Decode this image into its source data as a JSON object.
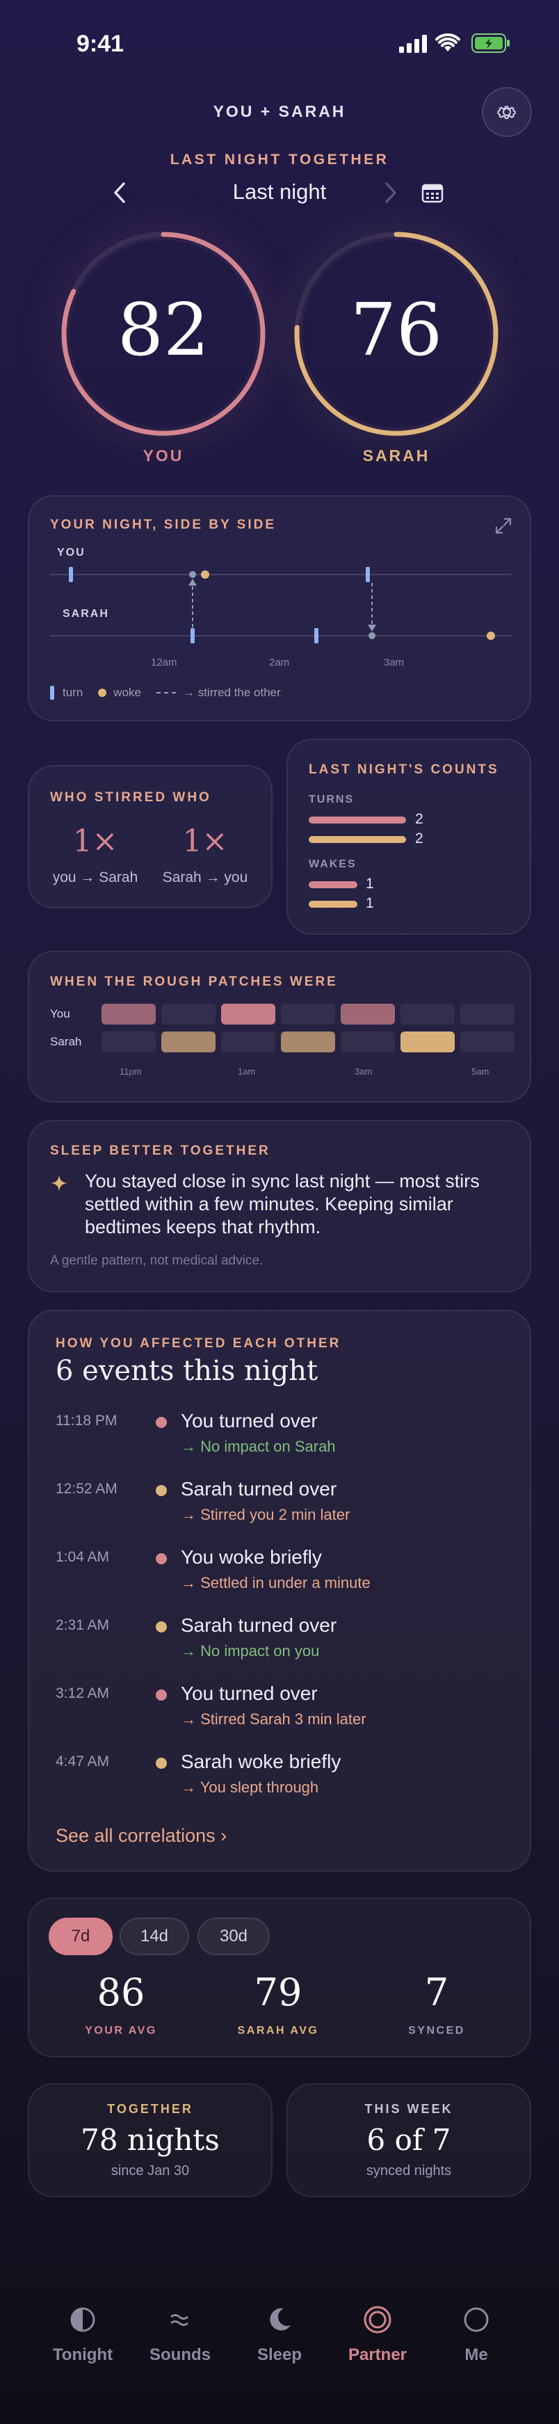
{
  "status_bar": {
    "time": "9:41"
  },
  "header": {
    "title": "YOU + SARAH",
    "subtitle": "LAST NIGHT TOGETHER",
    "date_label": "Last night"
  },
  "scores": {
    "you": {
      "value": "82",
      "label": "YOU",
      "color": "#d4868f",
      "progress": 0.82
    },
    "sarah": {
      "value": "76",
      "label": "SARAH",
      "color": "#e0b57c",
      "progress": 0.76
    }
  },
  "side_by_side": {
    "title": "YOUR NIGHT, SIDE BY SIDE",
    "rows": [
      "YOU",
      "SARAH"
    ],
    "ticks": [
      "12am",
      "2am",
      "3am"
    ],
    "legend": {
      "turn": "turn",
      "woke": "woke",
      "stirred": "→ stirred the other"
    }
  },
  "who_stirred": {
    "title": "WHO STIRRED WHO",
    "items": [
      {
        "count": "1×",
        "label": "you → Sarah"
      },
      {
        "count": "1×",
        "label": "Sarah → you"
      }
    ]
  },
  "counts": {
    "title": "LAST NIGHT'S COUNTS",
    "turns_label": "TURNS",
    "turns": [
      {
        "value": "2",
        "fraction": 1.0
      },
      {
        "value": "2",
        "fraction": 1.0
      }
    ],
    "wakes_label": "WAKES",
    "wakes": [
      {
        "value": "1",
        "fraction": 0.5
      },
      {
        "value": "1",
        "fraction": 0.5
      }
    ]
  },
  "rough_patches": {
    "title": "WHEN THE ROUGH PATCHES WERE",
    "rows": [
      {
        "label": "You",
        "levels": [
          0.55,
          0.1,
          0.9,
          0.1,
          0.6,
          0.1,
          0.1
        ]
      },
      {
        "label": "Sarah",
        "levels": [
          0.1,
          0.6,
          0.1,
          0.6,
          0.1,
          0.95,
          0.1
        ]
      }
    ],
    "ticks": [
      "11pm",
      "1am",
      "3am",
      "5am"
    ]
  },
  "sleep_better": {
    "title": "SLEEP BETTER TOGETHER",
    "body": "You stayed close in sync last night — most stirs settled within a few minutes. Keeping similar bedtimes keeps that rhythm.",
    "disclaimer": "A gentle pattern, not medical advice."
  },
  "affected": {
    "eyebrow": "HOW YOU AFFECTED EACH OTHER",
    "title": "6 events this night",
    "events": [
      {
        "time": "11:18 PM",
        "who": "you",
        "title": "You turned over",
        "detail": "→ No impact on Sarah",
        "impact": "none"
      },
      {
        "time": "12:52 AM",
        "who": "sarah",
        "title": "Sarah turned over",
        "detail": "→ Stirred you 2 min later",
        "impact": "stirred"
      },
      {
        "time": "1:04 AM",
        "who": "you",
        "title": "You woke briefly",
        "detail": "→ Settled in under a minute",
        "impact": "stirred"
      },
      {
        "time": "2:31 AM",
        "who": "sarah",
        "title": "Sarah turned over",
        "detail": "→ No impact on you",
        "impact": "none"
      },
      {
        "time": "3:12 AM",
        "who": "you",
        "title": "You turned over",
        "detail": "→ Stirred Sarah 3 min later",
        "impact": "stirred"
      },
      {
        "time": "4:47 AM",
        "who": "sarah",
        "title": "Sarah woke briefly",
        "detail": "→ You slept through",
        "impact": "stirred"
      }
    ],
    "link": "See all correlations ›"
  },
  "averages": {
    "tabs": [
      "7d",
      "14d",
      "30d"
    ],
    "selected_tab": "7d",
    "stats": [
      {
        "value": "86",
        "label": "YOUR AVG"
      },
      {
        "value": "79",
        "label": "SARAH AVG"
      },
      {
        "value": "7",
        "label": "SYNCED"
      }
    ]
  },
  "together": {
    "eyebrow": "TOGETHER",
    "value": "78 nights",
    "sub": "since Jan 30"
  },
  "this_week": {
    "eyebrow": "THIS WEEK",
    "value": "6 of 7",
    "sub": "synced nights"
  },
  "colors": {
    "you": "#d4868f",
    "sarah": "#e0b57c",
    "turn": "#8fb3f0",
    "accent": "#e8a98c",
    "green": "#7fbf7a"
  },
  "nav": {
    "items": [
      {
        "label": "Tonight",
        "icon": "moon-half-icon"
      },
      {
        "label": "Sounds",
        "icon": "waves-icon"
      },
      {
        "label": "Sleep",
        "icon": "crescent-moon-icon"
      },
      {
        "label": "Partner",
        "icon": "partner-rings-icon"
      },
      {
        "label": "Me",
        "icon": "profile-circle-icon"
      }
    ],
    "active": "Partner"
  }
}
